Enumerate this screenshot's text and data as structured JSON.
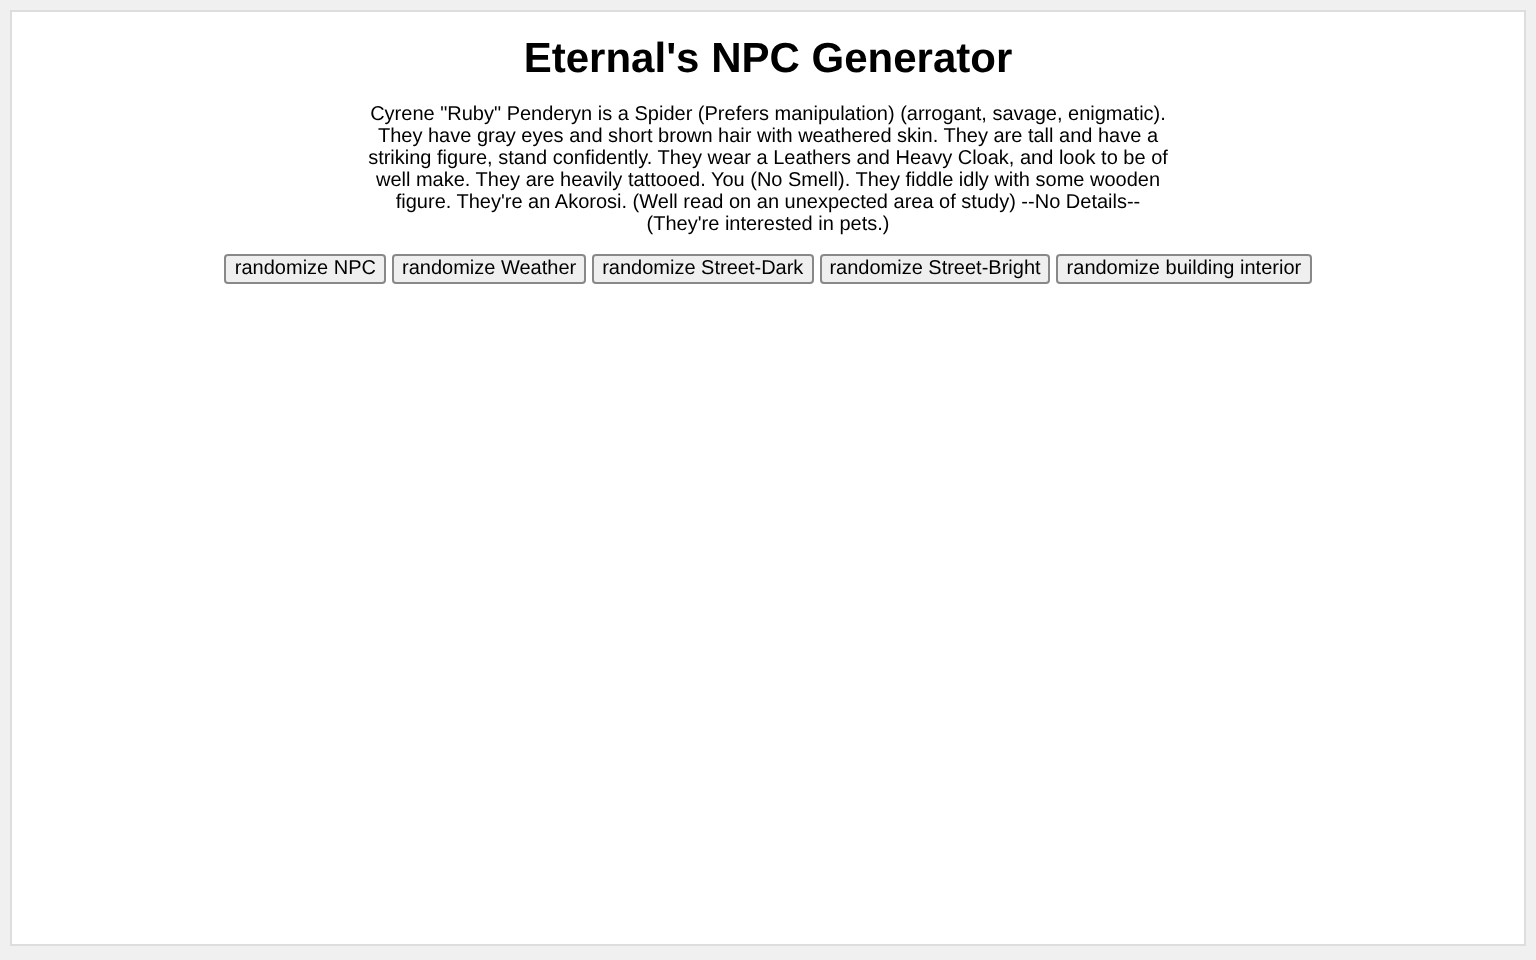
{
  "title": "Eternal's NPC Generator",
  "description": "Cyrene \"Ruby\" Penderyn is a Spider (Prefers manipulation) (arrogant, savage, enigmatic). They have gray eyes and short brown hair with weathered skin. They are tall and have a striking figure, stand confidently. They wear a Leathers and Heavy Cloak, and look to be of well make. They are heavily tattooed. You (No Smell). They fiddle idly with some wooden figure. They're an Akorosi. (Well read on an unexpected area of study) --No Details-- (They're interested in pets.)",
  "buttons": [
    "randomize NPC",
    "randomize Weather",
    "randomize Street-Dark",
    "randomize Street-Bright",
    "randomize building interior"
  ]
}
